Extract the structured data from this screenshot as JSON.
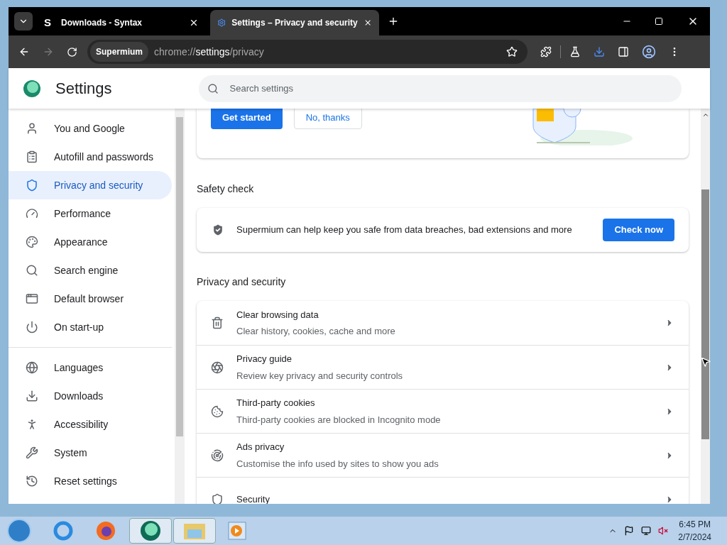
{
  "tabs": [
    {
      "title": "Downloads - Syntax",
      "favicon": "S",
      "selected": false
    },
    {
      "title": "Settings – Privacy and security",
      "selected": true
    }
  ],
  "toolbar": {
    "chip": "Supermium",
    "url_scheme": "chrome://",
    "url_host": "settings",
    "url_path": "/privacy"
  },
  "header": {
    "title": "Settings",
    "search": {
      "placeholder": "Search settings"
    }
  },
  "sidebar": {
    "groups": [
      [
        {
          "label": "You and Google",
          "selected": false
        },
        {
          "label": "Autofill and passwords",
          "selected": false
        },
        {
          "label": "Privacy and security",
          "selected": true
        },
        {
          "label": "Performance",
          "selected": false
        },
        {
          "label": "Appearance",
          "selected": false
        },
        {
          "label": "Search engine",
          "selected": false
        },
        {
          "label": "Default browser",
          "selected": false
        },
        {
          "label": "On start-up",
          "selected": false
        }
      ],
      [
        {
          "label": "Languages",
          "selected": false
        },
        {
          "label": "Downloads",
          "selected": false
        },
        {
          "label": "Accessibility",
          "selected": false
        },
        {
          "label": "System",
          "selected": false
        },
        {
          "label": "Reset settings",
          "selected": false
        }
      ]
    ]
  },
  "guide_card": {
    "primary_button": "Get started",
    "secondary_button": "No, thanks"
  },
  "safety_check": {
    "heading": "Safety check",
    "text": "Supermium can help keep you safe from data breaches, bad extensions and more",
    "button": "Check now"
  },
  "privacy": {
    "heading": "Privacy and security",
    "rows": [
      {
        "title": "Clear browsing data",
        "subtitle": "Clear history, cookies, cache and more"
      },
      {
        "title": "Privacy guide",
        "subtitle": "Review key privacy and security controls"
      },
      {
        "title": "Third-party cookies",
        "subtitle": "Third-party cookies are blocked in Incognito mode"
      },
      {
        "title": "Ads privacy",
        "subtitle": "Customise the info used by sites to show you ads"
      },
      {
        "title": "Security"
      }
    ]
  },
  "taskbar": {
    "time": "6:45 PM",
    "date": "2/7/2024"
  }
}
